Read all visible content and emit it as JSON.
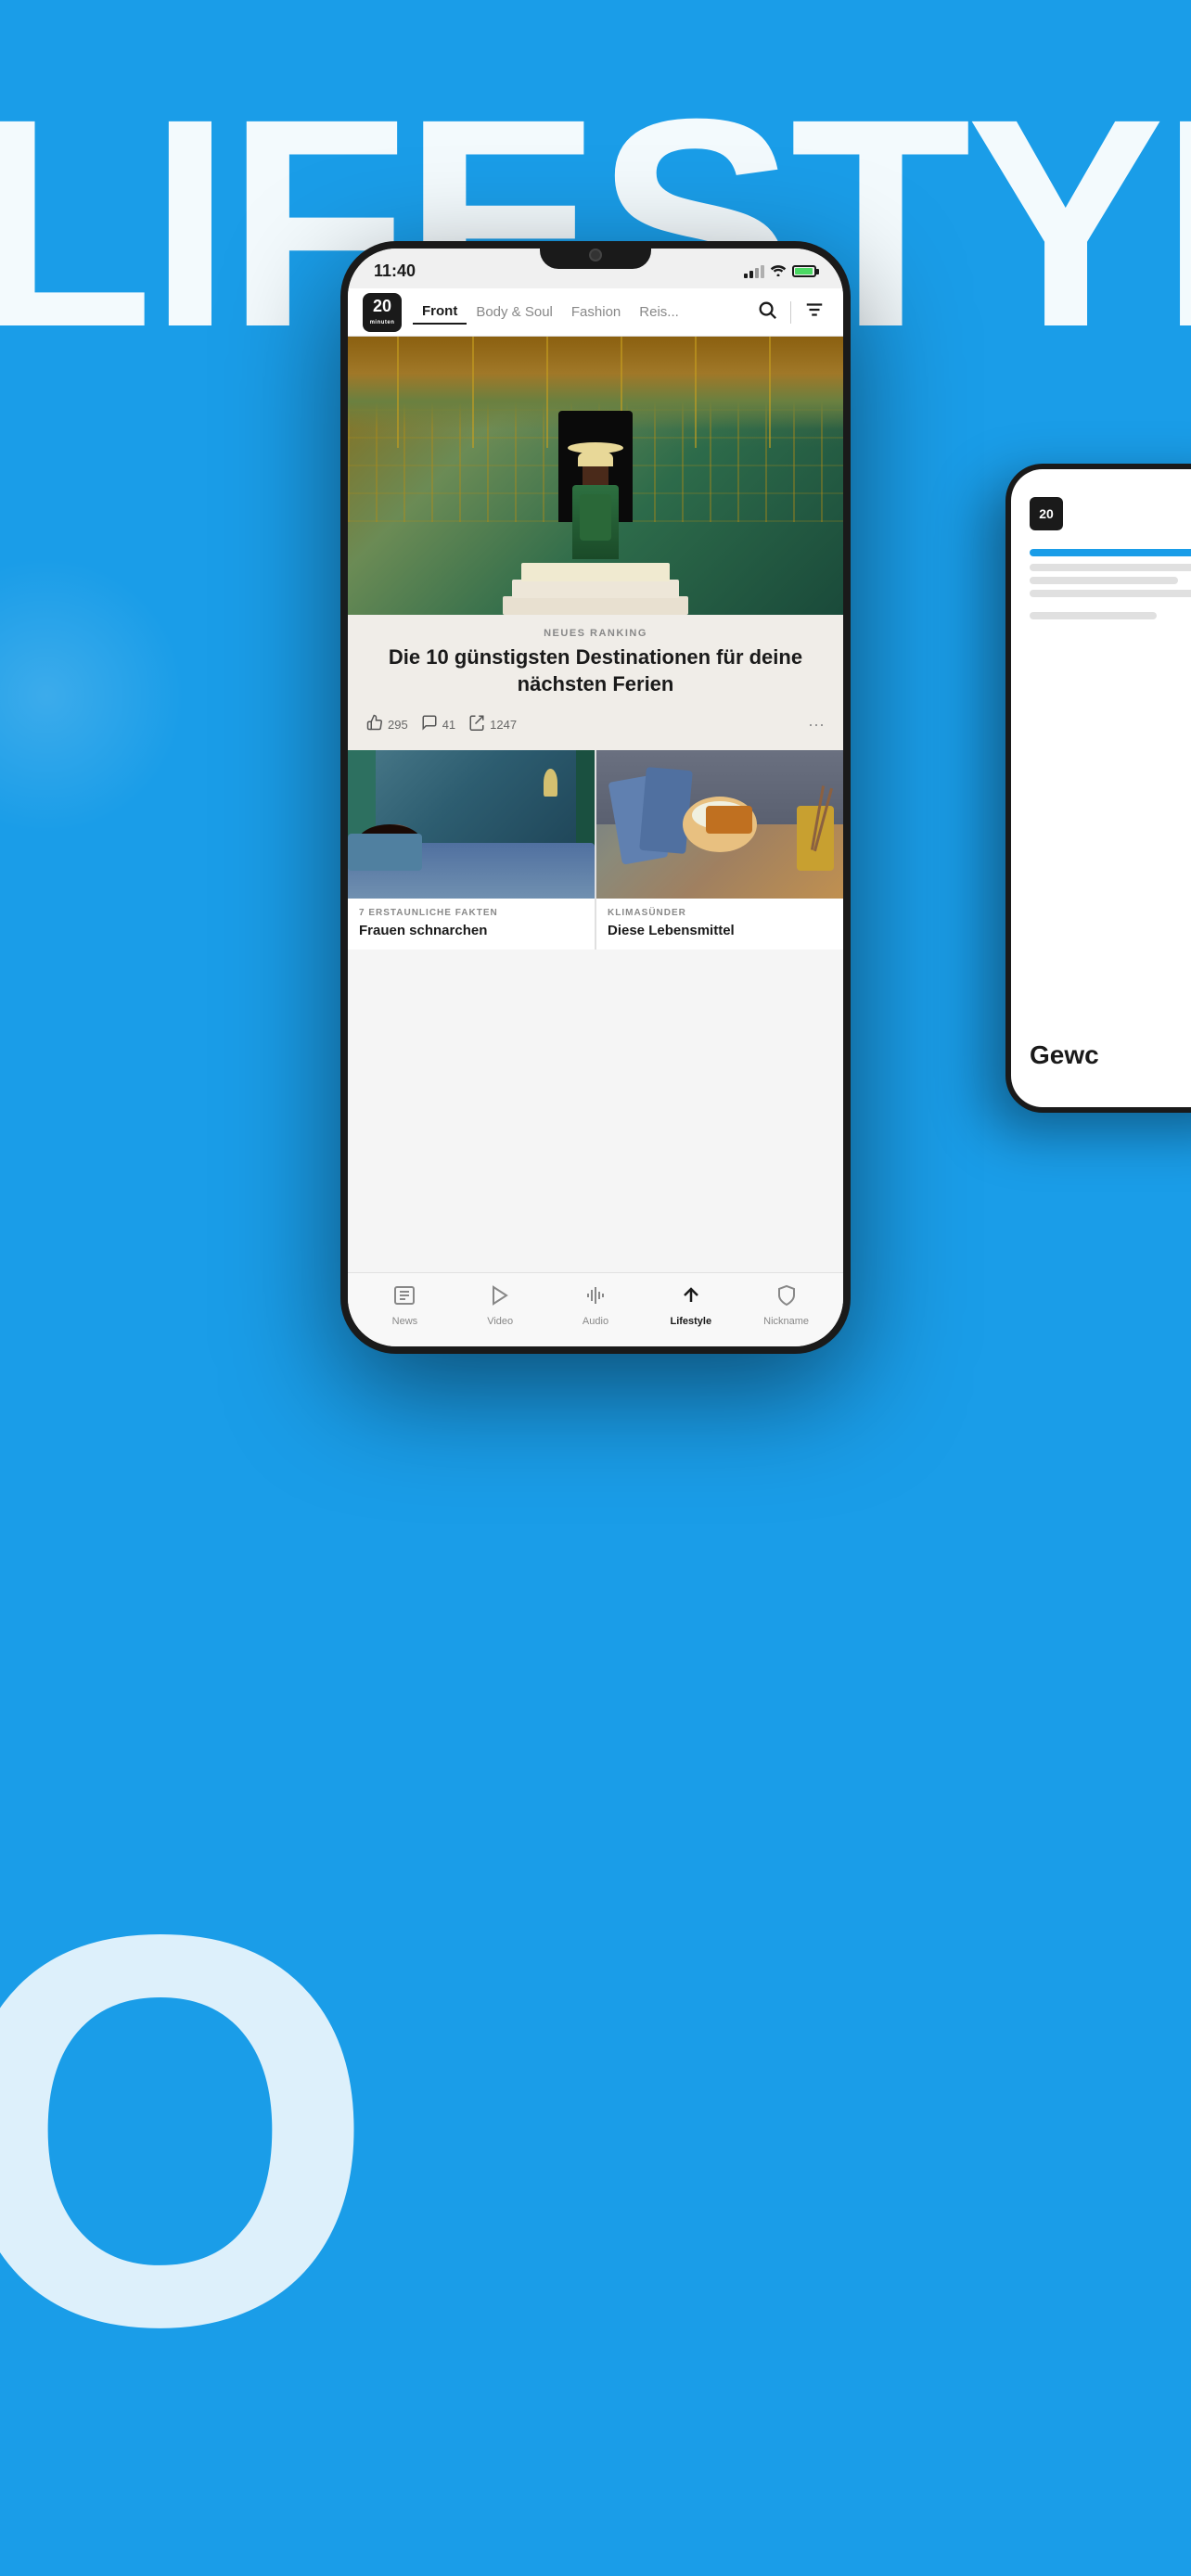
{
  "background": {
    "lifestyle_text": "LIFESTYLE",
    "o_letter": "O"
  },
  "phone": {
    "status_bar": {
      "time": "11:40"
    },
    "nav": {
      "logo_number": "20",
      "logo_sub": "minuten",
      "tabs": [
        {
          "label": "Front",
          "active": true
        },
        {
          "label": "Body & Soul",
          "active": false
        },
        {
          "label": "Fashion",
          "active": false
        },
        {
          "label": "Reis...",
          "active": false
        }
      ]
    },
    "hero": {
      "label": "NEUES RANKING",
      "title": "Die 10 günstigsten Destinationen für deine nächsten Ferien",
      "stats": {
        "likes": "295",
        "comments": "41",
        "shares": "1247"
      }
    },
    "cards": [
      {
        "label": "7 ERSTAUNLICHE FAKTEN",
        "title": "Frauen schnarchen"
      },
      {
        "label": "KLIMASÜNDER",
        "title": "Diese Lebensmittel"
      }
    ],
    "bottom_tabs": [
      {
        "label": "News",
        "icon": "📰",
        "active": false
      },
      {
        "label": "Video",
        "icon": "▶",
        "active": false
      },
      {
        "label": "Audio",
        "icon": "🎵",
        "active": false
      },
      {
        "label": "Lifestyle",
        "icon": "⬆",
        "active": true
      },
      {
        "label": "Nickname",
        "icon": "🛡",
        "active": false
      }
    ]
  },
  "right_phone": {
    "gewc_text": "Gewc"
  }
}
